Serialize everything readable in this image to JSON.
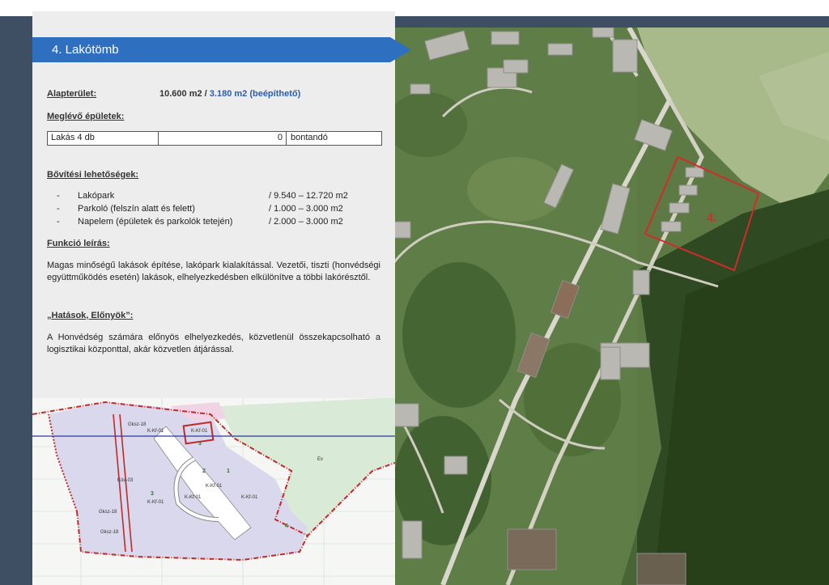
{
  "header": {
    "title": "4.  Lakótömb"
  },
  "area": {
    "label": "Alapterület:",
    "value": "10.600 m2 / ",
    "value_buildable": "3.180 m2 (beépíthető)"
  },
  "existing": {
    "label": "Meglévő épületek:",
    "row": {
      "name": "Lakás 4 db",
      "count": "0",
      "status": "bontandó"
    }
  },
  "expansion": {
    "label": "Bővítési lehetőségek:",
    "items": [
      {
        "dash": "-",
        "name": "Lakópark",
        "value": "/ 9.540 – 12.720 m2"
      },
      {
        "dash": "-",
        "name": "Parkoló (felszín alatt és felett)",
        "value": "/ 1.000 – 3.000 m2"
      },
      {
        "dash": "-",
        "name": "Napelem (épületek és parkolók tetején)",
        "value": "/ 2.000 – 3.000 m2"
      }
    ]
  },
  "function": {
    "label": "Funkció leírás:",
    "text": "Magas minőségű lakások építése, lakópark kialakítással. Vezetői, tiszti (honvédségi együttműködés esetén) lakások, elhelyezkedésben elkülönítve a többi lakórésztől."
  },
  "effects": {
    "label": "„Hatások, Előnyök”:",
    "text": "A Honvédség számára előnyös elhelyezkedés, közvetlenül összekapcsolható a logisztikai központtal, akár közvetlen átjárással."
  },
  "aerial": {
    "plot_label": "4."
  },
  "map": {
    "zones": [
      "Gksz-18",
      "K-Kf-01",
      "K-Kf-01",
      "Köu-03",
      "K-Kf-01",
      "K-Kf-01",
      "K-Kf-01",
      "Gksz-18",
      "Gksz-18",
      "K-Kf-01",
      "Ev"
    ],
    "numbers": [
      "3",
      "2",
      "1",
      "3",
      "4"
    ]
  },
  "colors": {
    "header": "#2f6fc0",
    "frame": "#3e4e63",
    "panel": "#ededed",
    "plot_outline": "#d42a2a"
  }
}
